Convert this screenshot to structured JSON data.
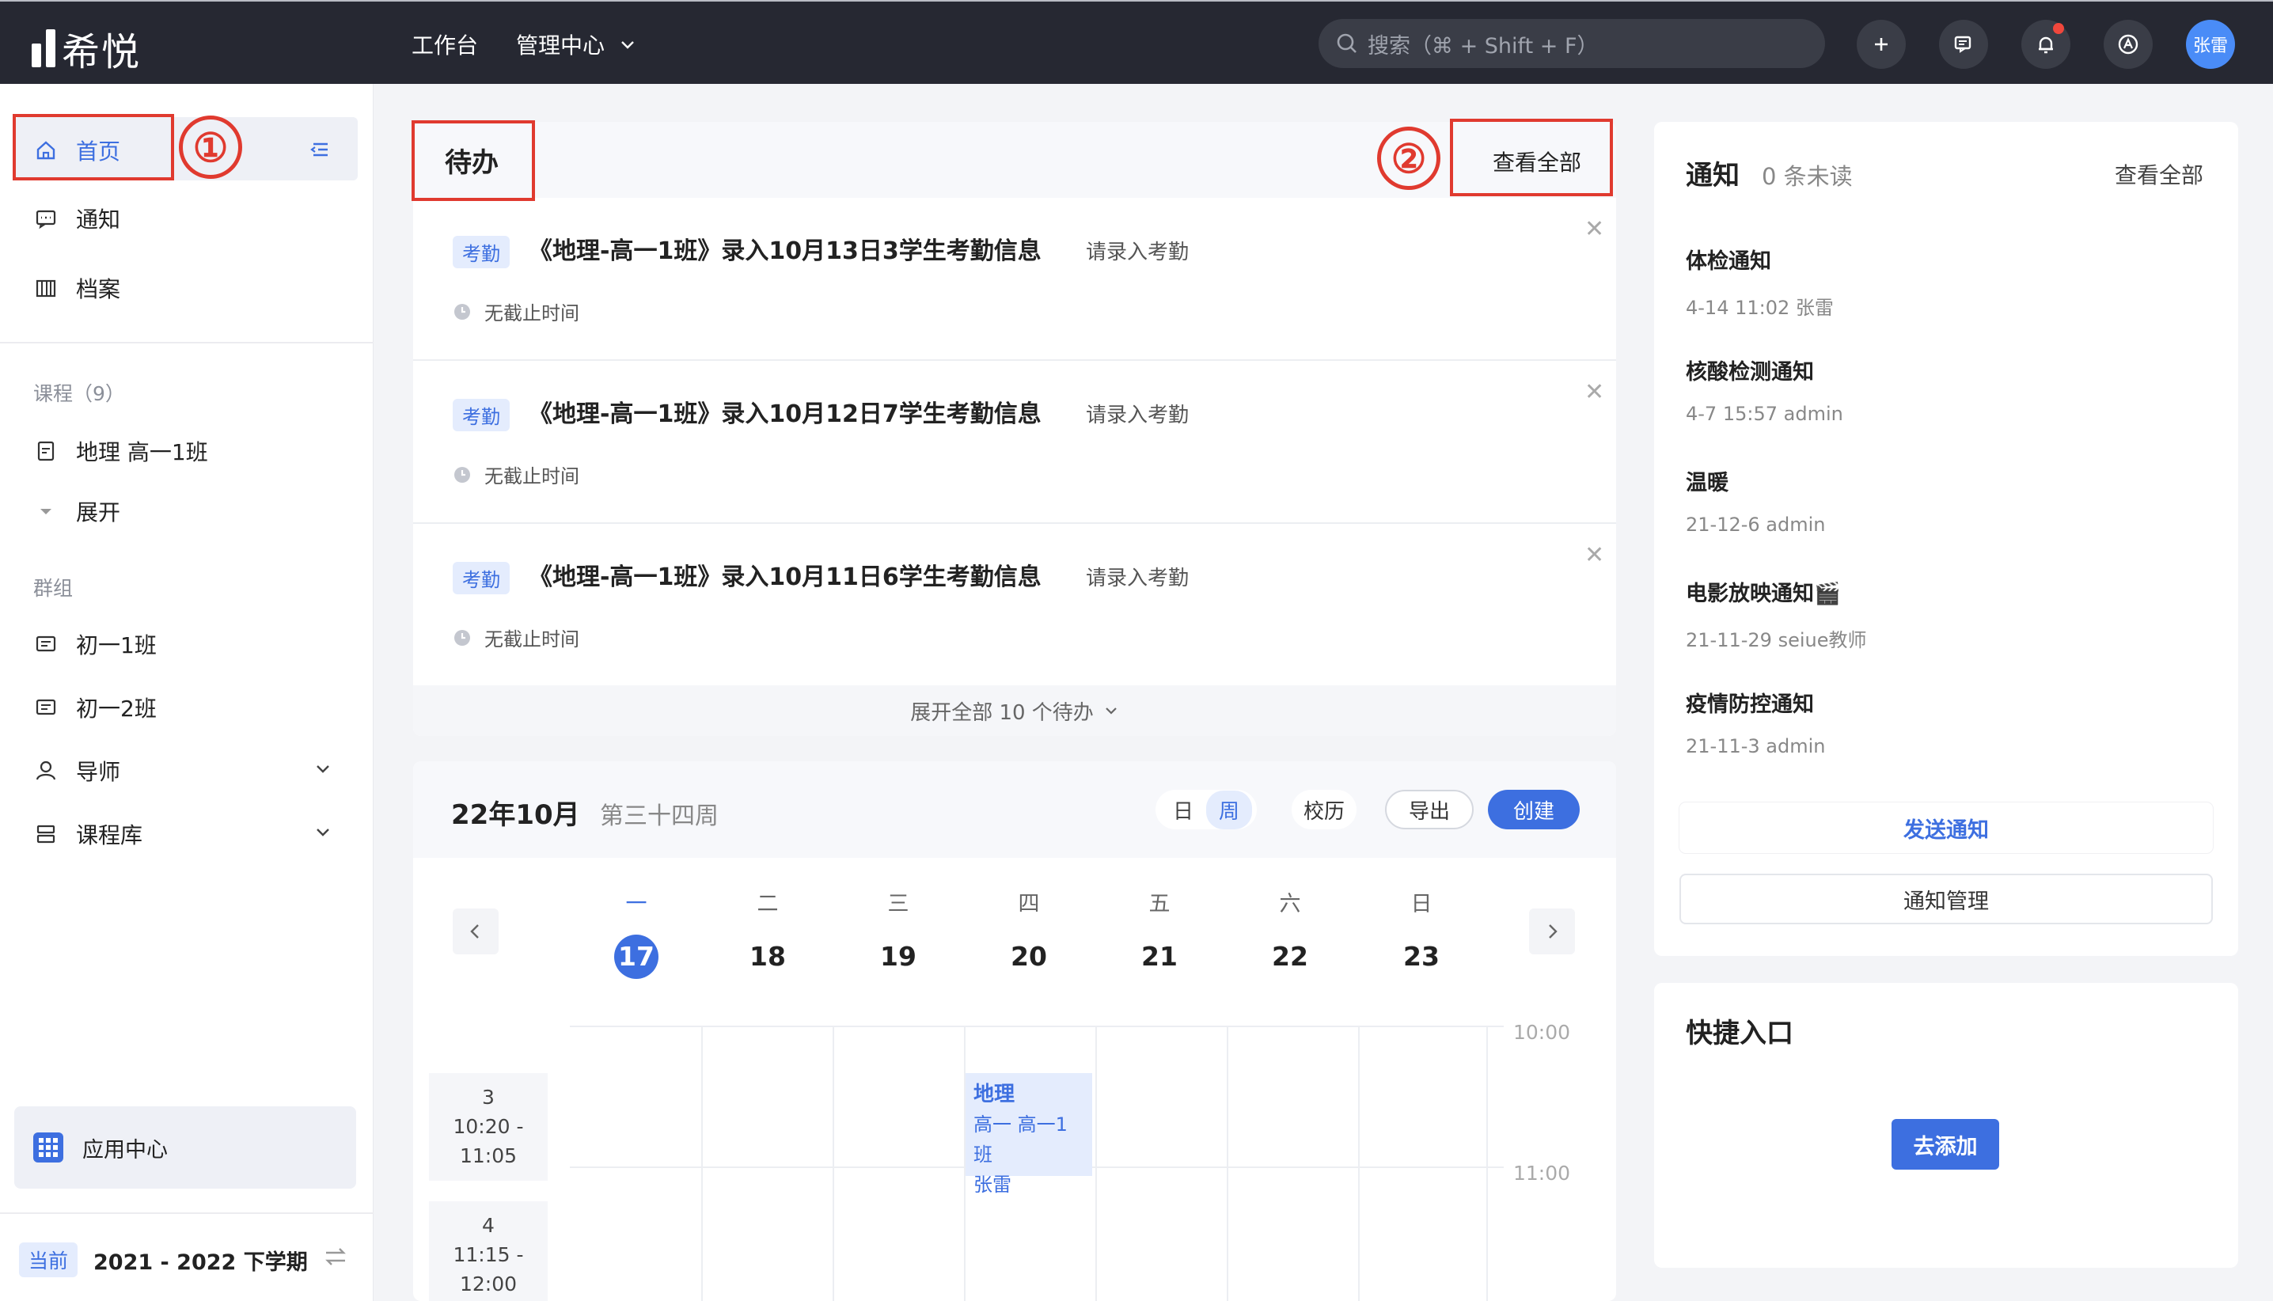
{
  "app": {
    "name": "希悦"
  },
  "topnav": {
    "workbench": "工作台",
    "admin_center": "管理中心"
  },
  "search": {
    "placeholder": "搜索（⌘ + Shift + F）"
  },
  "user": {
    "avatar_text": "张雷"
  },
  "sidebar": {
    "home": "首页",
    "notify": "通知",
    "archive": "档案",
    "courses_section": "课程（9）",
    "course_item": "地理 高一1班",
    "expand": "展开",
    "groups_section": "群组",
    "group_1": "初一1班",
    "group_2": "初一2班",
    "mentor": "导师",
    "course_lib": "课程库",
    "app_center": "应用中心",
    "term_badge": "当前",
    "term": "2021 - 2022 下学期"
  },
  "annotations": {
    "one": "①",
    "two": "②"
  },
  "todo": {
    "title": "待办",
    "view_all": "查看全部",
    "items": [
      {
        "tag": "考勤",
        "text": "《地理-高一1班》录入10月13日3学生考勤信息",
        "hint": "请录入考勤",
        "deadline": "无截止时间"
      },
      {
        "tag": "考勤",
        "text": "《地理-高一1班》录入10月12日7学生考勤信息",
        "hint": "请录入考勤",
        "deadline": "无截止时间"
      },
      {
        "tag": "考勤",
        "text": "《地理-高一1班》录入10月11日6学生考勤信息",
        "hint": "请录入考勤",
        "deadline": "无截止时间"
      }
    ],
    "expand_all": "展开全部 10 个待办"
  },
  "calendar": {
    "month": "22年10月",
    "week": "第三十四周",
    "views": {
      "day": "日",
      "week": "周"
    },
    "school_cal": "校历",
    "export": "导出",
    "create": "创建",
    "days": [
      {
        "wd": "一",
        "dn": "17"
      },
      {
        "wd": "二",
        "dn": "18"
      },
      {
        "wd": "三",
        "dn": "19"
      },
      {
        "wd": "四",
        "dn": "20"
      },
      {
        "wd": "五",
        "dn": "21"
      },
      {
        "wd": "六",
        "dn": "22"
      },
      {
        "wd": "日",
        "dn": "23"
      }
    ],
    "hours": [
      "10:00",
      "11:00"
    ],
    "periods": [
      {
        "n": "3",
        "start": "10:20 -",
        "end": "11:05"
      },
      {
        "n": "4",
        "start": "11:15 -",
        "end": "12:00"
      }
    ],
    "event": {
      "title": "地理",
      "class": "高一  高一1班",
      "teacher": "张雷"
    }
  },
  "notice": {
    "title": "通知",
    "unread": "0 条未读",
    "view_all": "查看全部",
    "items": [
      {
        "title": "体检通知",
        "meta": "4-14 11:02  张雷"
      },
      {
        "title": "核酸检测通知",
        "meta": "4-7 15:57  admin"
      },
      {
        "title": "温暖",
        "meta": "21-12-6  admin"
      },
      {
        "title": "电影放映通知🎬",
        "meta": "21-11-29  seiue教师"
      },
      {
        "title": "疫情防控通知",
        "meta": "21-11-3  admin"
      }
    ],
    "send": "发送通知",
    "manage": "通知管理"
  },
  "quick": {
    "title": "快捷入口",
    "add": "去添加"
  }
}
